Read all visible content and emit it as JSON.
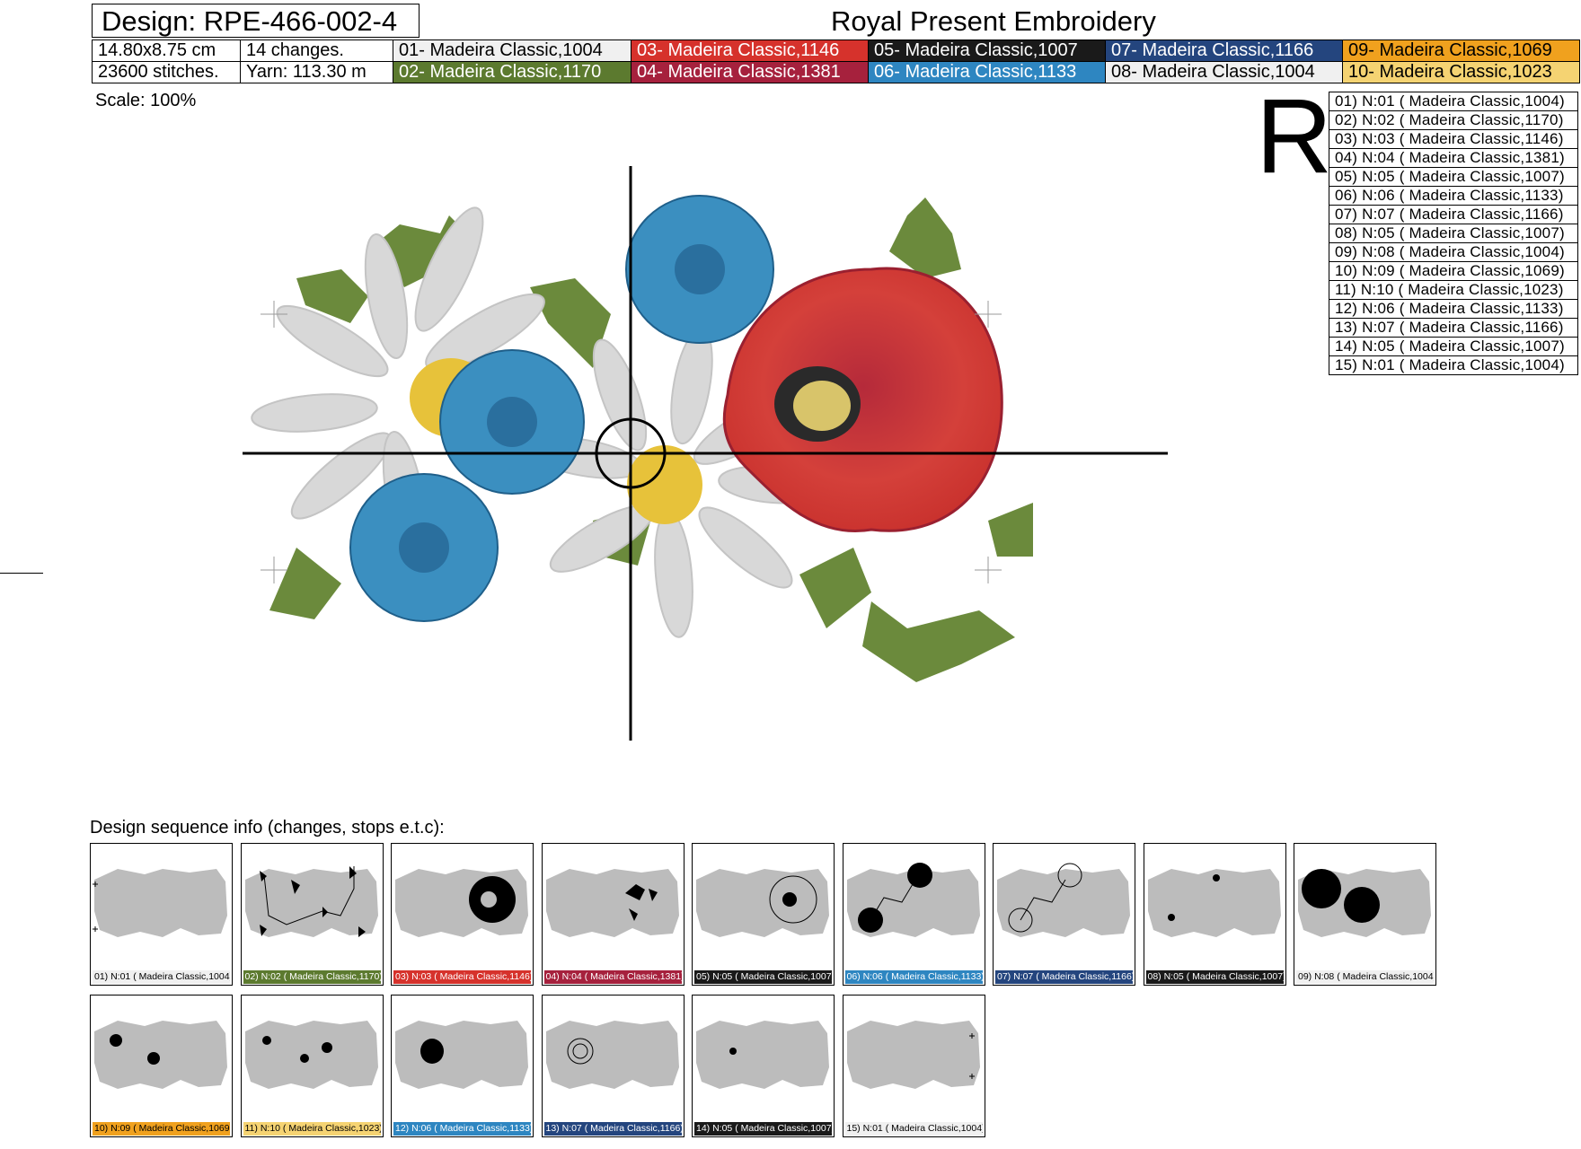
{
  "header": {
    "design_title": "Design: RPE-466-002-4",
    "brand": "Royal Present Embroidery",
    "size": "14.80x8.75 cm",
    "changes": "14 changes.",
    "stitches": "23600 stitches.",
    "yarn": "Yarn: 113.30 m"
  },
  "threads": [
    {
      "label": "01- Madeira Classic,1004",
      "bg": "#f0f0f0",
      "fg": "#000000"
    },
    {
      "label": "03- Madeira Classic,1146",
      "bg": "#d6322c",
      "fg": "#ffffff"
    },
    {
      "label": "05- Madeira Classic,1007",
      "bg": "#1a1a1a",
      "fg": "#ffffff"
    },
    {
      "label": "07- Madeira Classic,1166",
      "bg": "#24457e",
      "fg": "#ffffff"
    },
    {
      "label": "09- Madeira Classic,1069",
      "bg": "#f0a11e",
      "fg": "#000000"
    },
    {
      "label": "02- Madeira Classic,1170",
      "bg": "#5c7a2f",
      "fg": "#ffffff"
    },
    {
      "label": "04- Madeira Classic,1381",
      "bg": "#a6213d",
      "fg": "#ffffff"
    },
    {
      "label": "06- Madeira Classic,1133",
      "bg": "#2e86c1",
      "fg": "#ffffff"
    },
    {
      "label": "08- Madeira Classic,1004",
      "bg": "#f0f0f0",
      "fg": "#000000"
    },
    {
      "label": "10- Madeira Classic,1023",
      "bg": "#f5d372",
      "fg": "#000000"
    }
  ],
  "scale": "Scale: 100%",
  "orientation_mark": "R",
  "sequence_list": [
    "01) N:01 ( Madeira Classic,1004)",
    "02) N:02 ( Madeira Classic,1170)",
    "03) N:03 ( Madeira Classic,1146)",
    "04) N:04 ( Madeira Classic,1381)",
    "05) N:05 ( Madeira Classic,1007)",
    "06) N:06 ( Madeira Classic,1133)",
    "07) N:07 ( Madeira Classic,1166)",
    "08) N:05 ( Madeira Classic,1007)",
    "09) N:08 ( Madeira Classic,1004)",
    "10) N:09 ( Madeira Classic,1069)",
    "11) N:10 ( Madeira Classic,1023)",
    "12) N:06 ( Madeira Classic,1133)",
    "13) N:07 ( Madeira Classic,1166)",
    "14) N:05 ( Madeira Classic,1007)",
    "15) N:01 ( Madeira Classic,1004)"
  ],
  "sequence_title": "Design sequence info (changes, stops e.t.c):",
  "steps": [
    {
      "caption": "01) N:01 ( Madeira Classic,1004)",
      "bg": "#f0f0f0",
      "fg": "#000000",
      "highlight": "plus"
    },
    {
      "caption": "02) N:02 ( Madeira Classic,1170)",
      "bg": "#5c7a2f",
      "fg": "#ffffff",
      "highlight": "leaves"
    },
    {
      "caption": "03) N:03 ( Madeira Classic,1146)",
      "bg": "#d6322c",
      "fg": "#ffffff",
      "highlight": "poppy"
    },
    {
      "caption": "04) N:04 ( Madeira Classic,1381)",
      "bg": "#a6213d",
      "fg": "#ffffff",
      "highlight": "poppy-shade"
    },
    {
      "caption": "05) N:05 ( Madeira Classic,1007)",
      "bg": "#1a1a1a",
      "fg": "#ffffff",
      "highlight": "poppy-outline"
    },
    {
      "caption": "06) N:06 ( Madeira Classic,1133)",
      "bg": "#2e86c1",
      "fg": "#ffffff",
      "highlight": "cornflowers"
    },
    {
      "caption": "07) N:07 ( Madeira Classic,1166)",
      "bg": "#24457e",
      "fg": "#ffffff",
      "highlight": "cornflower-detail"
    },
    {
      "caption": "08) N:05 ( Madeira Classic,1007)",
      "bg": "#1a1a1a",
      "fg": "#ffffff",
      "highlight": "cornflower-centers"
    },
    {
      "caption": "09) N:08 ( Madeira Classic,1004)",
      "bg": "#f0f0f0",
      "fg": "#000000",
      "highlight": "daisies"
    },
    {
      "caption": "10) N:09 ( Madeira Classic,1069)",
      "bg": "#f0a11e",
      "fg": "#000000",
      "highlight": "daisy-centers"
    },
    {
      "caption": "11) N:10 ( Madeira Classic,1023)",
      "bg": "#f5d372",
      "fg": "#000000",
      "highlight": "daisy-centers-2"
    },
    {
      "caption": "12) N:06 ( Madeira Classic,1133)",
      "bg": "#2e86c1",
      "fg": "#ffffff",
      "highlight": "corn-center"
    },
    {
      "caption": "13) N:07 ( Madeira Classic,1166)",
      "bg": "#24457e",
      "fg": "#ffffff",
      "highlight": "corn-outline"
    },
    {
      "caption": "14) N:05 ( Madeira Classic,1007)",
      "bg": "#1a1a1a",
      "fg": "#ffffff",
      "highlight": "small-dot"
    },
    {
      "caption": "15) N:01 ( Madeira Classic,1004)",
      "bg": "#f0f0f0",
      "fg": "#000000",
      "highlight": "plus-end"
    }
  ]
}
